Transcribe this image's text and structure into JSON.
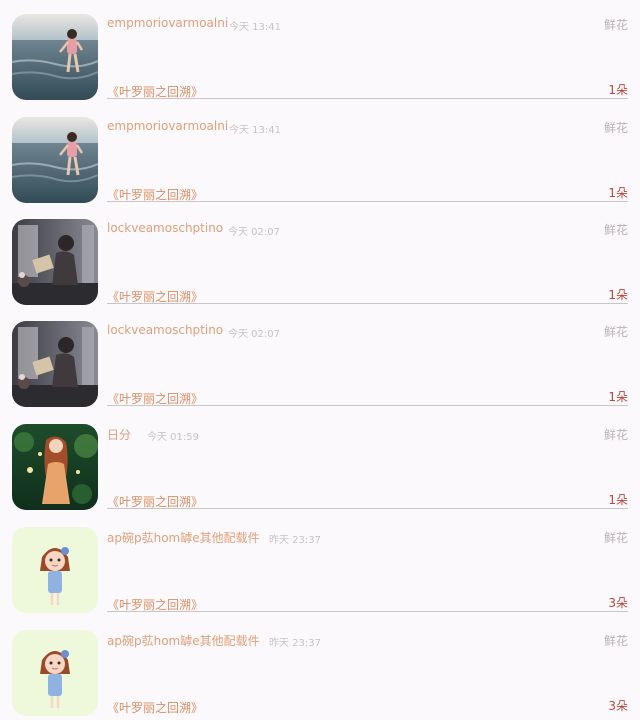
{
  "items": [
    {
      "username": "empmoriovarmoalni",
      "time": "今天 13:41",
      "gift_type": "鲜花",
      "book": "《叶罗丽之回溯》",
      "count": "1朵",
      "avatar_icon": "beach-girl-photo"
    },
    {
      "username": "empmoriovarmoalni",
      "time": "今天 13:41",
      "gift_type": "鲜花",
      "book": "《叶罗丽之回溯》",
      "count": "1朵",
      "avatar_icon": "beach-girl-photo"
    },
    {
      "username": "lockveamoschptino",
      "time": "今天 02:07",
      "gift_type": "鲜花",
      "book": "《叶罗丽之回溯》",
      "count": "1朵",
      "avatar_icon": "reading-woman-photo"
    },
    {
      "username": "lockveamoschptino",
      "time": "今天 02:07",
      "gift_type": "鲜花",
      "book": "《叶罗丽之回溯》",
      "count": "1朵",
      "avatar_icon": "reading-woman-photo"
    },
    {
      "username": "日分",
      "time": "今天 01:59",
      "gift_type": "鲜花",
      "book": "《叶罗丽之回溯》",
      "count": "1朵",
      "avatar_icon": "forest-girl-illustration"
    },
    {
      "username": "ap碗p苰hom罅e其他配载件",
      "time": "昨天 23:37",
      "gift_type": "鲜花",
      "book": "《叶罗丽之回溯》",
      "count": "3朵",
      "avatar_icon": "cartoon-girl-illustration"
    },
    {
      "username": "ap碗p苰hom罅e其他配载件",
      "time": "昨天 23:37",
      "gift_type": "鲜花",
      "book": "《叶罗丽之回溯》",
      "count": "3朵",
      "avatar_icon": "cartoon-girl-illustration"
    }
  ]
}
